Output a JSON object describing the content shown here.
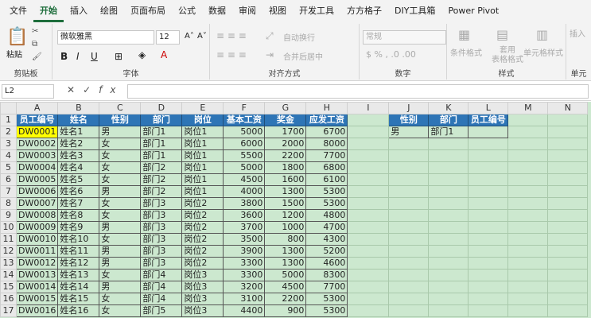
{
  "ribbon": {
    "tabs": [
      "文件",
      "开始",
      "插入",
      "绘图",
      "页面布局",
      "公式",
      "数据",
      "审阅",
      "视图",
      "开发工具",
      "方方格子",
      "DIY工具箱",
      "Power Pivot"
    ],
    "paste_label": "粘贴",
    "clipboard_label": "剪贴板",
    "font_name": "微软雅黑",
    "font_size": "12",
    "font_label": "字体",
    "wrap_text": "自动换行",
    "merge_center": "合并后居中",
    "align_label": "对齐方式",
    "number_format": "常规",
    "number_label": "数字",
    "cond_format": "条件格式",
    "table_format": "套用\n表格格式",
    "cell_style": "单元格样式",
    "styles_label": "样式",
    "cells_label": "单元",
    "insert_label": "插入"
  },
  "formula_bar": {
    "name_box": "L2",
    "fx": "fx",
    "value": ""
  },
  "grid": {
    "columns": [
      "A",
      "B",
      "C",
      "D",
      "E",
      "F",
      "G",
      "H",
      "I",
      "J",
      "K",
      "L",
      "M",
      "N"
    ],
    "headers": [
      "员工编号",
      "姓名",
      "性别",
      "部门",
      "岗位",
      "基本工资",
      "奖金",
      "应发工资"
    ],
    "rows": [
      [
        "DW0001",
        "姓名1",
        "男",
        "部门1",
        "岗位1",
        "5000",
        "1700",
        "6700"
      ],
      [
        "DW0002",
        "姓名2",
        "女",
        "部门1",
        "岗位1",
        "6000",
        "2000",
        "8000"
      ],
      [
        "DW0003",
        "姓名3",
        "女",
        "部门1",
        "岗位1",
        "5500",
        "2200",
        "7700"
      ],
      [
        "DW0004",
        "姓名4",
        "女",
        "部门2",
        "岗位1",
        "5000",
        "1800",
        "6800"
      ],
      [
        "DW0005",
        "姓名5",
        "女",
        "部门2",
        "岗位1",
        "4500",
        "1600",
        "6100"
      ],
      [
        "DW0006",
        "姓名6",
        "男",
        "部门2",
        "岗位1",
        "4000",
        "1300",
        "5300"
      ],
      [
        "DW0007",
        "姓名7",
        "女",
        "部门3",
        "岗位2",
        "3800",
        "1500",
        "5300"
      ],
      [
        "DW0008",
        "姓名8",
        "女",
        "部门3",
        "岗位2",
        "3600",
        "1200",
        "4800"
      ],
      [
        "DW0009",
        "姓名9",
        "男",
        "部门3",
        "岗位2",
        "3700",
        "1000",
        "4700"
      ],
      [
        "DW0010",
        "姓名10",
        "女",
        "部门3",
        "岗位2",
        "3500",
        "800",
        "4300"
      ],
      [
        "DW0011",
        "姓名11",
        "男",
        "部门3",
        "岗位2",
        "3900",
        "1300",
        "5200"
      ],
      [
        "DW0012",
        "姓名12",
        "男",
        "部门3",
        "岗位2",
        "3300",
        "1300",
        "4600"
      ],
      [
        "DW0013",
        "姓名13",
        "女",
        "部门4",
        "岗位3",
        "3300",
        "5000",
        "8300"
      ],
      [
        "DW0014",
        "姓名14",
        "男",
        "部门4",
        "岗位3",
        "3200",
        "4500",
        "7700"
      ],
      [
        "DW0015",
        "姓名15",
        "女",
        "部门4",
        "岗位3",
        "3100",
        "2200",
        "5300"
      ],
      [
        "DW0016",
        "姓名16",
        "女",
        "部门5",
        "岗位3",
        "4400",
        "900",
        "5300"
      ]
    ],
    "lookup_headers": [
      "性别",
      "部门",
      "员工编号"
    ],
    "lookup_values": [
      "男",
      "部门1",
      ""
    ]
  }
}
